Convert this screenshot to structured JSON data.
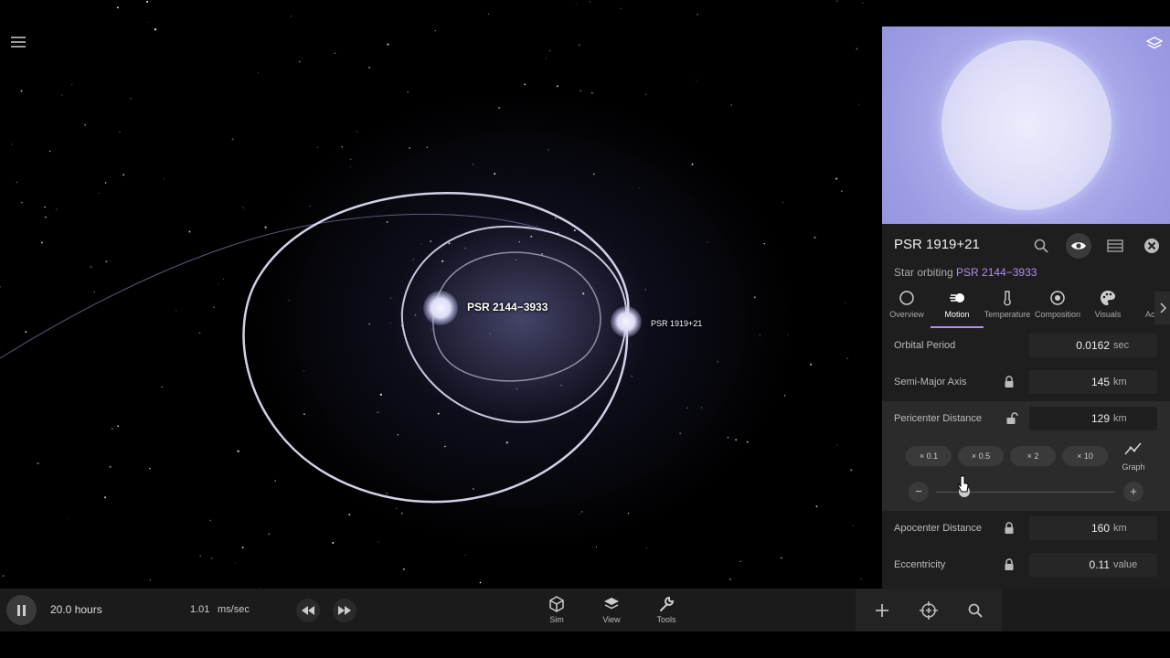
{
  "scene": {
    "primary_label": "PSR 2144−3933",
    "secondary_label": "PSR 1919+21"
  },
  "timebar": {
    "time": "20.0 hours",
    "rate_value": "1.01",
    "rate_unit": "ms/sec"
  },
  "toolbar": {
    "sim_label": "Sim",
    "view_label": "View",
    "tools_label": "Tools"
  },
  "panel": {
    "title": "PSR 1919+21",
    "subtitle_prefix": "Star orbiting",
    "subtitle_link": "PSR 2144−3933",
    "tabs": [
      {
        "label": "Overview",
        "icon": "circle-icon"
      },
      {
        "label": "Motion",
        "icon": "motion-icon",
        "active": true
      },
      {
        "label": "Temperature",
        "icon": "thermometer-icon"
      },
      {
        "label": "Composition",
        "icon": "composition-icon"
      },
      {
        "label": "Visuals",
        "icon": "palette-icon"
      },
      {
        "label": "Ac",
        "icon": "more-tab-icon"
      }
    ],
    "properties": [
      {
        "label": "Orbital Period",
        "value": "0.0162",
        "unit": "sec",
        "lock": "none"
      },
      {
        "label": "Semi-Major Axis",
        "value": "145",
        "unit": "km",
        "lock": "locked"
      },
      {
        "label": "Pericenter Distance",
        "value": "129",
        "unit": "km",
        "lock": "unlocked"
      },
      {
        "label": "Apocenter Distance",
        "value": "160",
        "unit": "km",
        "lock": "locked"
      },
      {
        "label": "Eccentricity",
        "value": "0.11",
        "unit": "value",
        "lock": "locked"
      }
    ],
    "multipliers": [
      "× 0.1",
      "× 0.5",
      "× 2",
      "× 10"
    ],
    "graph_label": "Graph",
    "minus_label": "−",
    "plus_label": "+",
    "slider_level": 0.16
  },
  "colors": {
    "accent": "#b28cf0",
    "panel_bg": "#1e1e1e",
    "preview_star": "#c8c8f2"
  }
}
